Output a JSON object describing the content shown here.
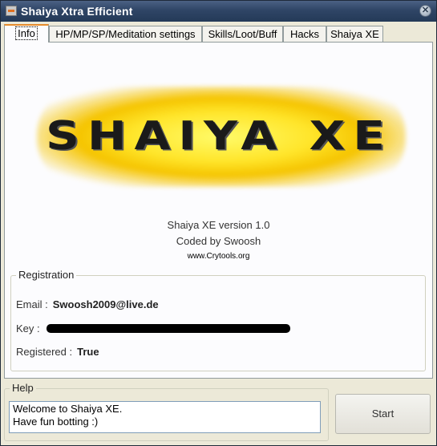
{
  "window": {
    "title": "Shaiya Xtra Efficient",
    "close_glyph": "✕"
  },
  "tabs": [
    {
      "label": "Info"
    },
    {
      "label": "HP/MP/SP/Meditation settings"
    },
    {
      "label": "Skills/Loot/Buff"
    },
    {
      "label": "Hacks"
    },
    {
      "label": "Shaiya XE"
    }
  ],
  "info": {
    "logo_text": "SHAIYA XE",
    "version": "Shaiya XE version 1.0",
    "coded_by": "Coded by Swoosh",
    "website": "www.Crytools.org"
  },
  "registration": {
    "group_label": "Registration",
    "email_label": "Email :",
    "email_value": "Swoosh2009@live.de",
    "key_label": "Key :",
    "registered_label": "Registered :",
    "registered_value": "True"
  },
  "help": {
    "group_label": "Help",
    "line1": "Welcome to Shaiya XE.",
    "line2": "Have fun botting :)"
  },
  "start_button": {
    "label": "Start"
  },
  "colors": {
    "titlebar": "#2f4566",
    "active_tab_accent": "#e68b2c",
    "logo_glow": "#ffe52a"
  }
}
